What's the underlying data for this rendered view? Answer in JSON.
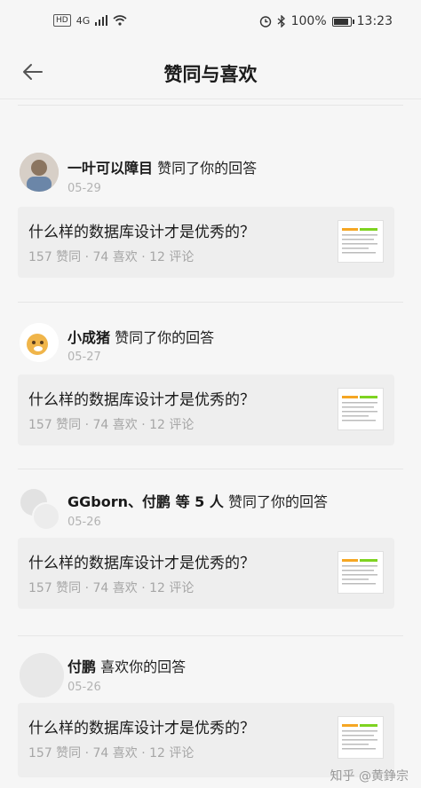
{
  "status_bar": {
    "hd": "HD",
    "network": "4G",
    "battery": "100%",
    "battery_level": 1.0,
    "time": "13:23"
  },
  "nav": {
    "title": "赞同与喜欢",
    "back_icon": "arrow-left-icon"
  },
  "notifications": [
    {
      "actor": "一叶可以障目",
      "action": "赞同了你的回答",
      "date": "05-29",
      "card": {
        "title": "什么样的数据库设计才是优秀的？",
        "stats": "157 赞同 · 74 喜欢 · 12 评论"
      }
    },
    {
      "actor": "小成猪",
      "action": "赞同了你的回答",
      "date": "05-27",
      "card": {
        "title": "什么样的数据库设计才是优秀的？",
        "stats": "157 赞同 · 74 喜欢 · 12 评论"
      }
    },
    {
      "actor": "GGborn、付鹏 等 5 人",
      "action": "赞同了你的回答",
      "date": "05-26",
      "card": {
        "title": "什么样的数据库设计才是优秀的？",
        "stats": "157 赞同 · 74 喜欢 · 12 评论"
      }
    },
    {
      "actor": "付鹏",
      "action": "喜欢你的回答",
      "date": "05-26",
      "card": {
        "title": "什么样的数据库设计才是优秀的？",
        "stats": "157 赞同 · 74 喜欢 · 12 评论"
      }
    }
  ],
  "watermark": "知乎 @黄錚宗",
  "colors": {
    "background": "#f6f6f6",
    "card": "#eeeeee",
    "muted": "#a6a6a6"
  }
}
